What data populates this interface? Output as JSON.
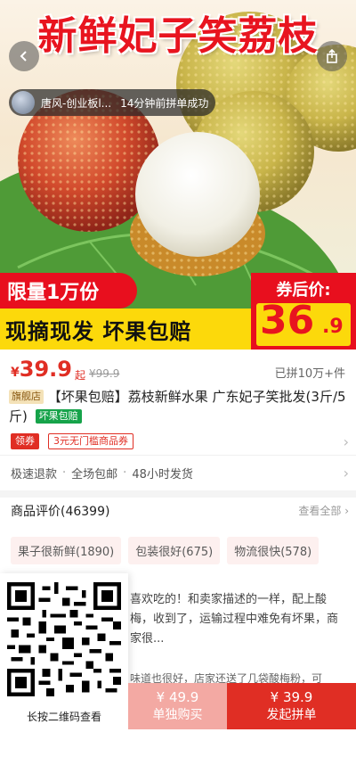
{
  "hero": {
    "banner_title": "新鲜妃子笑荔枝",
    "ticker_name": "唐风-创业板l...",
    "ticker_message": "14分钟前拼单成功",
    "promo_limited": "限量1万份",
    "promo_slogan": "现摘现发  坏果包赔",
    "promo_after_coupon_label": "券后价:",
    "promo_price_big": "36",
    "promo_price_small": ".9"
  },
  "price": {
    "currency": "¥",
    "current": "39.9",
    "qi": "起",
    "original": "¥99.9",
    "sold": "已拼10万+件"
  },
  "product": {
    "store_tag": "旗舰店",
    "title": "【坏果包赔】荔枝新鲜水果 广东妃子笑批发(3斤/5斤)",
    "green_tag": "坏果包赔"
  },
  "coupon": {
    "get_label": "领券",
    "coupon_text": "3元无门槛商品券"
  },
  "services": [
    "极速退款",
    "全场包邮",
    "48小时发货"
  ],
  "reviews": {
    "header": "商品评价(46399)",
    "view_all": "查看全部",
    "tags": [
      "果子很新鲜(1890)",
      "包装很好(675)",
      "物流很快(578)"
    ],
    "review_text": "喜欢吃的！和卖家描述的一样，配上酸梅，收到了，运输过程中难免有坏果，商家很...",
    "review2_text": "味道也很好，店家还送了几袋酸梅粉，可"
  },
  "qr": {
    "caption": "长按二维码查看"
  },
  "actions": {
    "single_price": "¥ 49.9",
    "single_label": "单独购买",
    "group_price": "¥ 39.9",
    "group_label": "发起拼单"
  },
  "colors": {
    "accent": "#e02e24",
    "promo_red": "#e80f1e",
    "promo_yellow": "#fcd90b",
    "single_button": "#f3a9a3"
  }
}
